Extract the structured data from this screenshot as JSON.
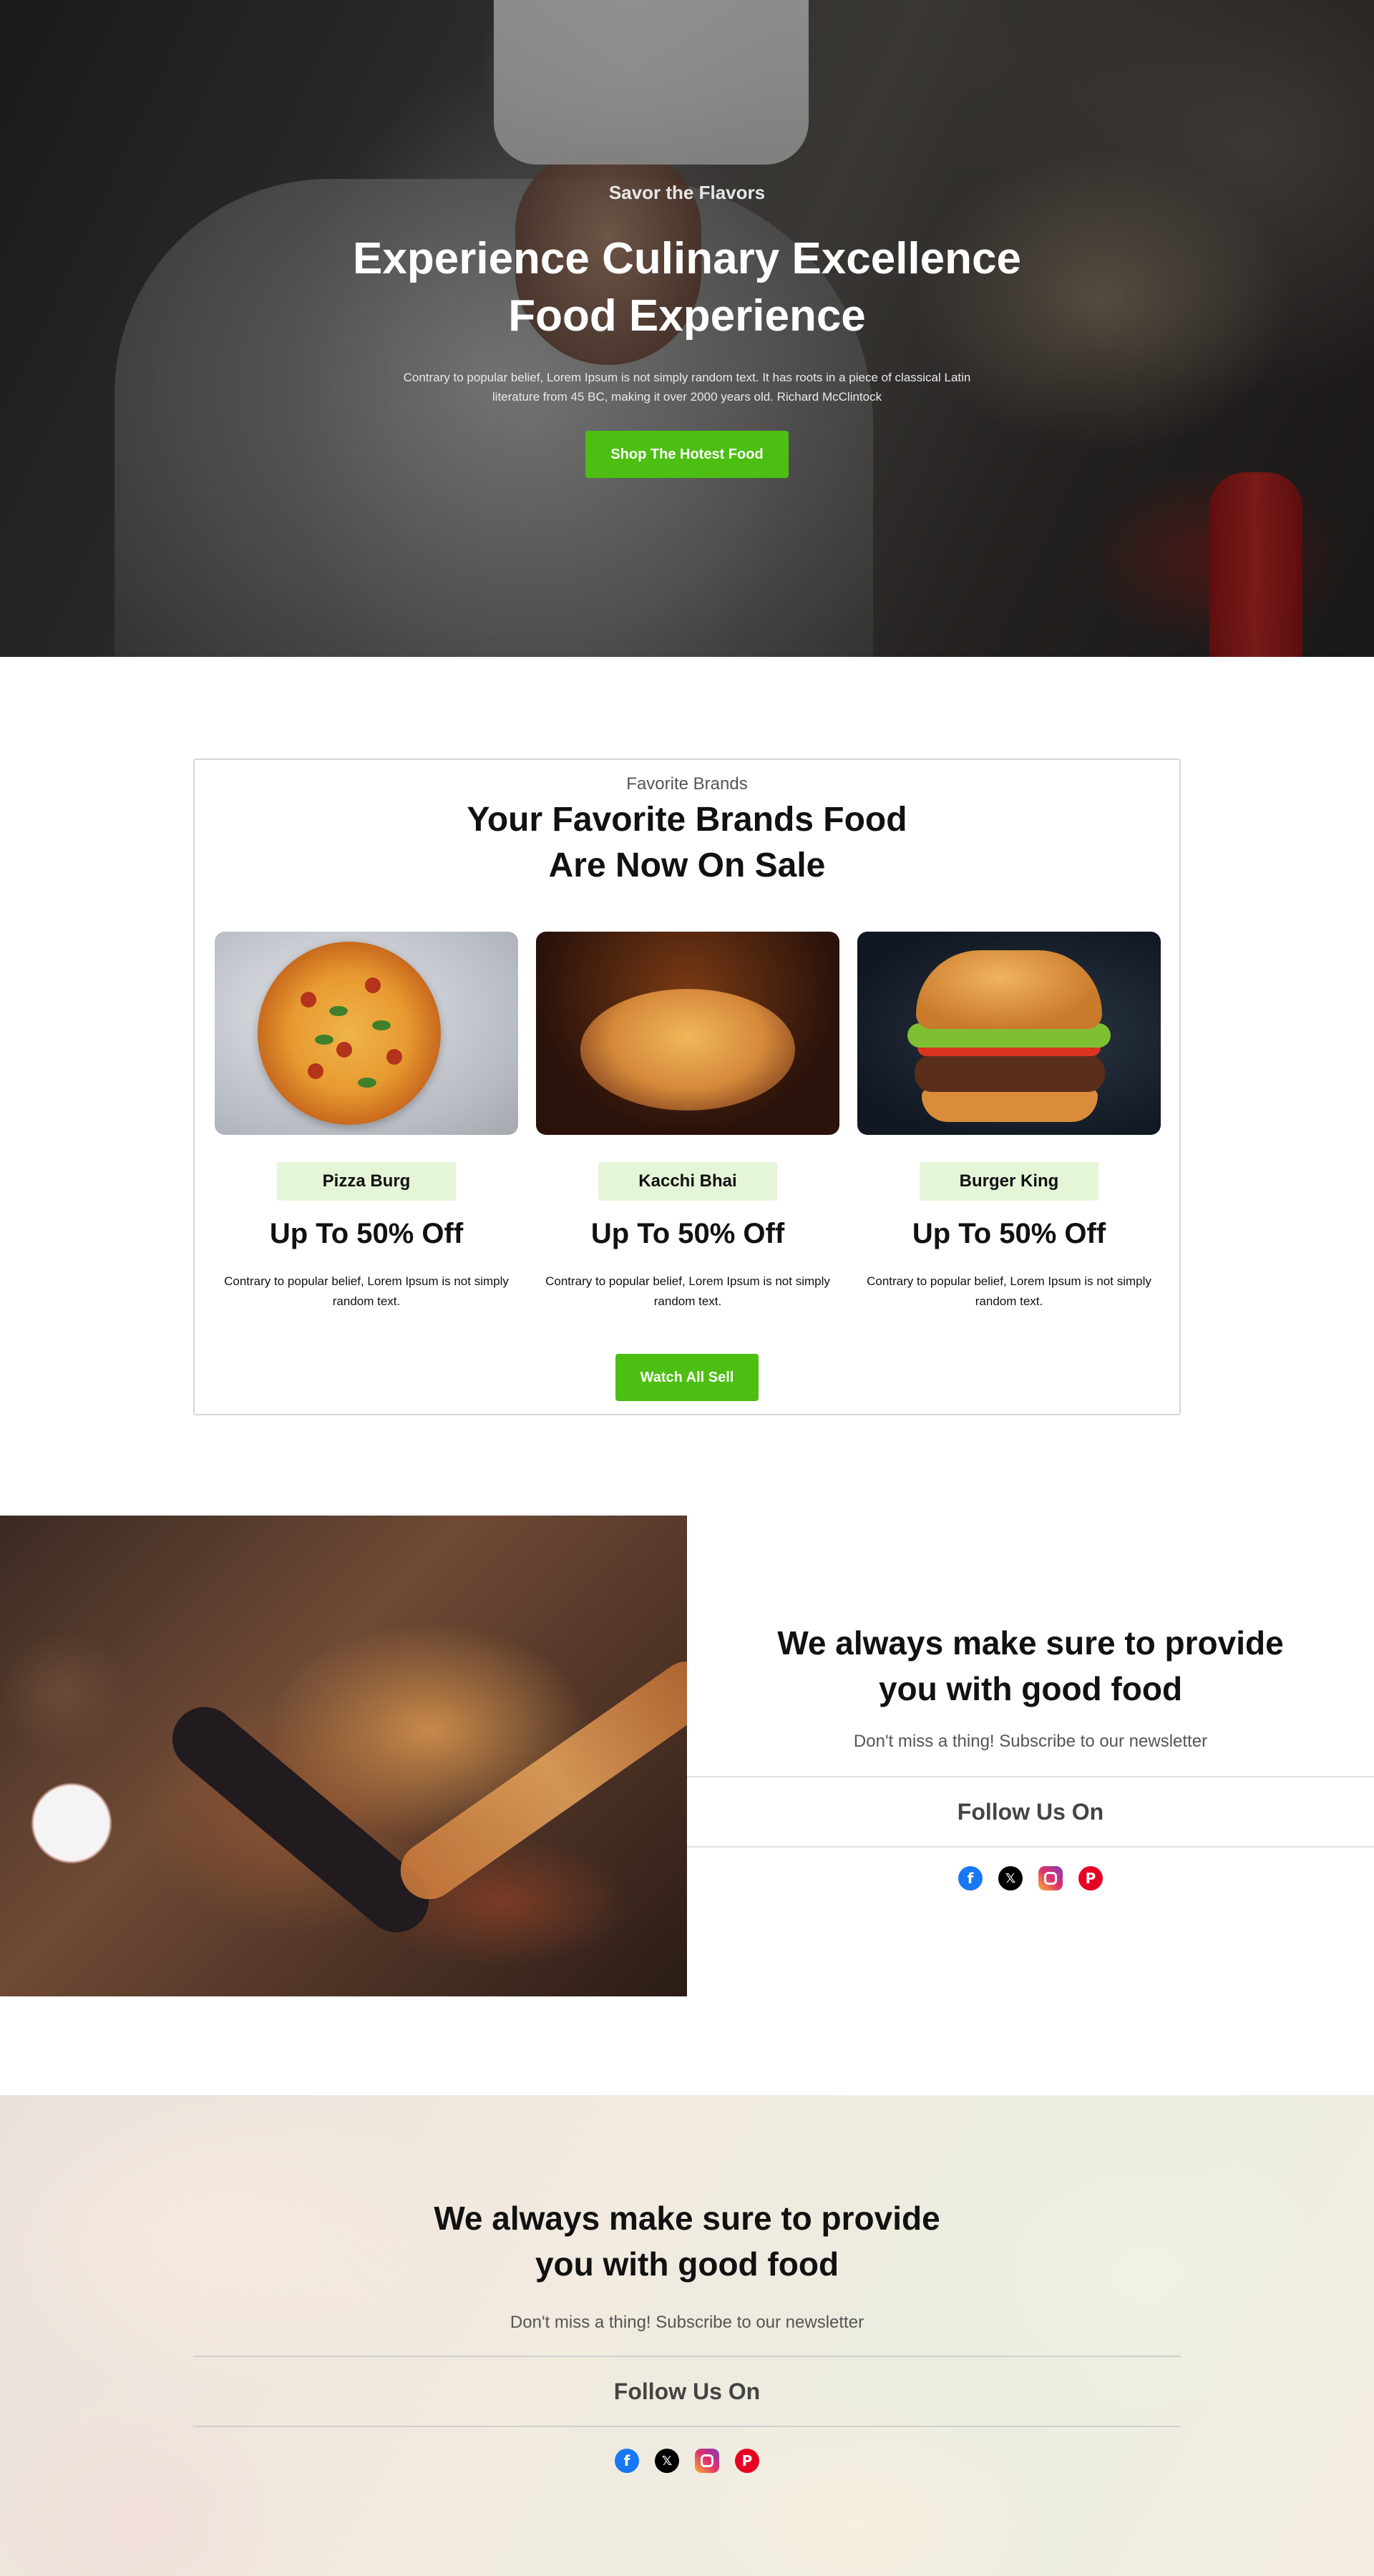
{
  "hero": {
    "eyebrow": "Savor the Flavors",
    "title_line1": "Experience Culinary Excellence",
    "title_line2": "Food Experience",
    "text_line1": "Contrary to popular belief, Lorem Ipsum is not simply random text. It has roots in a piece of classical Latin",
    "text_line2": "literature from 45 BC, making it over 2000 years old. Richard McClintock",
    "button_label": "Shop The Hotest Food"
  },
  "brands": {
    "eyebrow": "Favorite Brands",
    "title_line1": "Your Favorite Brands Food",
    "title_line2": "Are Now On Sale",
    "cards": [
      {
        "name": "Pizza Burg",
        "offer": "Up To 50% Off",
        "text": "Contrary to popular belief, Lorem Ipsum is not simply random text."
      },
      {
        "name": "Kacchi Bhai",
        "offer": "Up To 50% Off",
        "text": "Contrary to popular belief, Lorem Ipsum is not simply random text."
      },
      {
        "name": "Burger King",
        "offer": "Up To 50% Off",
        "text": "Contrary to popular belief, Lorem Ipsum is not simply random text."
      }
    ],
    "button_label": "Watch All Sell"
  },
  "newsletter": {
    "title_line1": "We always make sure to provide",
    "title_line2": "you with good food",
    "subtitle": "Don't miss a thing! Subscribe to our newsletter",
    "follow_label": "Follow Us On",
    "socials": [
      {
        "icon": "facebook-icon",
        "glyph": "f",
        "color": "#1877f2"
      },
      {
        "icon": "x-twitter-icon",
        "glyph": "𝕏",
        "color": "#000000"
      },
      {
        "icon": "instagram-icon",
        "glyph": "",
        "color": "#e1306c"
      },
      {
        "icon": "pinterest-icon",
        "glyph": "P",
        "color": "#e60023"
      }
    ]
  },
  "banner": {
    "title_line1": "We always make sure to provide",
    "title_line2": "you with good food",
    "subtitle": "Don't miss a thing! Subscribe to our newsletter",
    "follow_label": "Follow Us On"
  },
  "colors": {
    "accent_green": "#4cbf12",
    "tag_background": "#e5f5d8"
  }
}
